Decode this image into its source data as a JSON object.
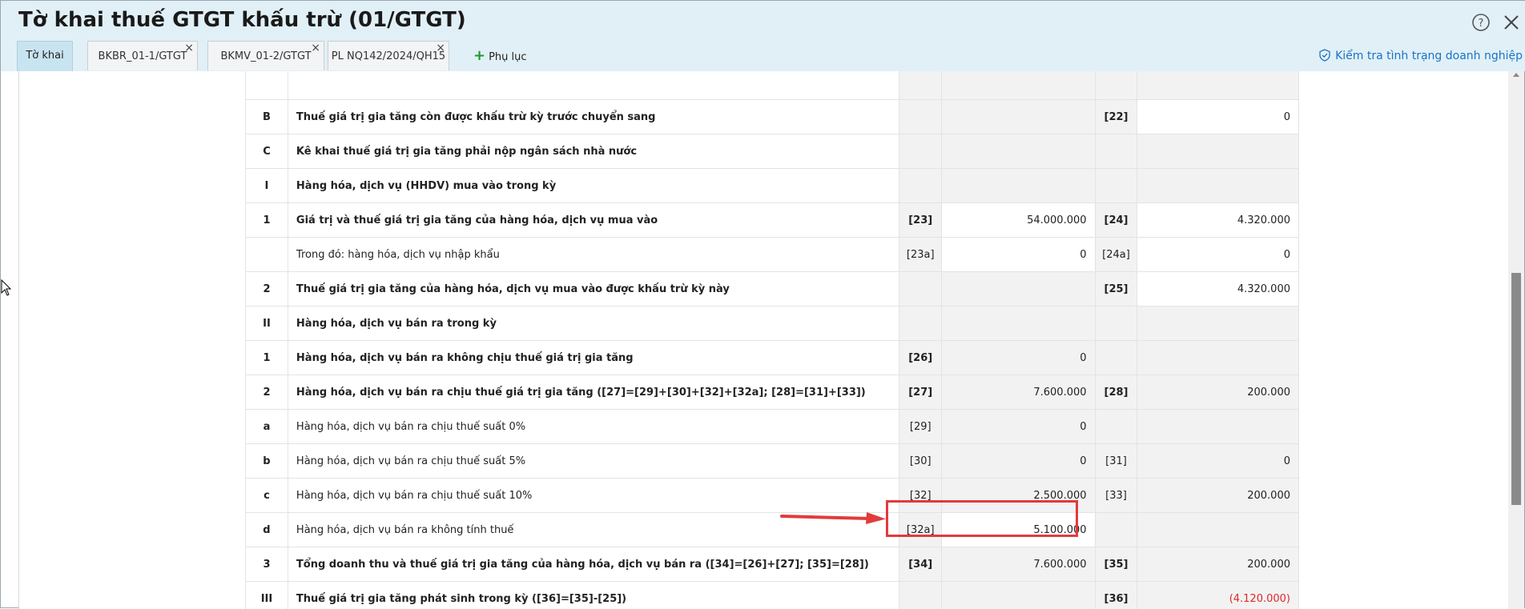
{
  "window": {
    "title": "Tờ khai thuế GTGT khấu trừ (01/GTGT)"
  },
  "tabs": [
    {
      "label": "Tờ khai",
      "active": true
    },
    {
      "label": "BKBR_01-1/GTGT",
      "closable": true
    },
    {
      "label": "BKMV_01-2/GTGT",
      "closable": true
    },
    {
      "label": "PL NQ142/2024/QH15",
      "closable": true
    }
  ],
  "add_appendix_label": "Phụ lục",
  "check_status_link": "Kiểm tra tình trạng doanh nghiệp",
  "close_glyph": "×",
  "rows": [
    {
      "num": "",
      "desc": "",
      "code": "",
      "val": "",
      "code2": "",
      "val2": ""
    },
    {
      "num": "B",
      "desc": "Thuế giá trị gia tăng còn được khấu trừ kỳ trước chuyển sang",
      "code": "",
      "val": "",
      "code2": "[22]",
      "val2": "0"
    },
    {
      "num": "C",
      "desc": "Kê khai thuế giá trị gia tăng phải nộp ngân sách nhà nước",
      "code": "",
      "val": "",
      "code2": "",
      "val2": ""
    },
    {
      "num": "I",
      "desc": "Hàng hóa, dịch vụ (HHDV) mua vào trong kỳ",
      "code": "",
      "val": "",
      "code2": "",
      "val2": ""
    },
    {
      "num": "1",
      "desc": "Giá trị và thuế giá trị gia tăng của hàng hóa, dịch vụ mua vào",
      "code": "[23]",
      "val": "54.000.000",
      "code2": "[24]",
      "val2": "4.320.000"
    },
    {
      "num": "",
      "desc": "Trong đó: hàng hóa, dịch vụ nhập khẩu",
      "code": "[23a]",
      "val": "0",
      "code2": "[24a]",
      "val2": "0"
    },
    {
      "num": "2",
      "desc": "Thuế giá trị gia tăng của hàng hóa, dịch vụ mua vào được khấu trừ kỳ này",
      "code": "",
      "val": "",
      "code2": "[25]",
      "val2": "4.320.000"
    },
    {
      "num": "II",
      "desc": "Hàng hóa, dịch vụ bán ra trong kỳ",
      "code": "",
      "val": "",
      "code2": "",
      "val2": ""
    },
    {
      "num": "1",
      "desc": "Hàng hóa, dịch vụ bán ra không chịu thuế giá trị gia tăng",
      "code": "[26]",
      "val": "0",
      "code2": "",
      "val2": ""
    },
    {
      "num": "2",
      "desc": "Hàng hóa, dịch vụ bán ra chịu thuế giá trị gia tăng ([27]=[29]+[30]+[32]+[32a]; [28]=[31]+[33])",
      "code": "[27]",
      "val": "7.600.000",
      "code2": "[28]",
      "val2": "200.000"
    },
    {
      "num": "a",
      "desc": "Hàng hóa, dịch vụ bán ra chịu thuế suất 0%",
      "code": "[29]",
      "val": "0",
      "code2": "",
      "val2": ""
    },
    {
      "num": "b",
      "desc": "Hàng hóa, dịch vụ bán ra chịu thuế suất 5%",
      "code": "[30]",
      "val": "0",
      "code2": "[31]",
      "val2": "0"
    },
    {
      "num": "c",
      "desc": "Hàng hóa, dịch vụ bán ra chịu thuế suất 10%",
      "code": "[32]",
      "val": "2.500.000",
      "code2": "[33]",
      "val2": "200.000"
    },
    {
      "num": "d",
      "desc": "Hàng hóa, dịch vụ bán ra không tính thuế",
      "code": "[32a]",
      "val": "5.100.000",
      "code2": "",
      "val2": ""
    },
    {
      "num": "3",
      "desc": "Tổng doanh thu và thuế giá trị gia tăng của hàng hóa, dịch vụ bán ra ([34]=[26]+[27]; [35]=[28])",
      "code": "[34]",
      "val": "7.600.000",
      "code2": "[35]",
      "val2": "200.000"
    },
    {
      "num": "III",
      "desc": "Thuế giá trị gia tăng phát sinh trong kỳ ([36]=[35]-[25])",
      "code": "",
      "val": "",
      "code2": "[36]",
      "val2": "(4.120.000)"
    }
  ],
  "colors": {
    "title_bar": "#e1f0f6",
    "active_tab": "#c9e4f1",
    "highlight": "#e23b3b",
    "negative": "#e0262b",
    "link": "#1a73c8"
  }
}
